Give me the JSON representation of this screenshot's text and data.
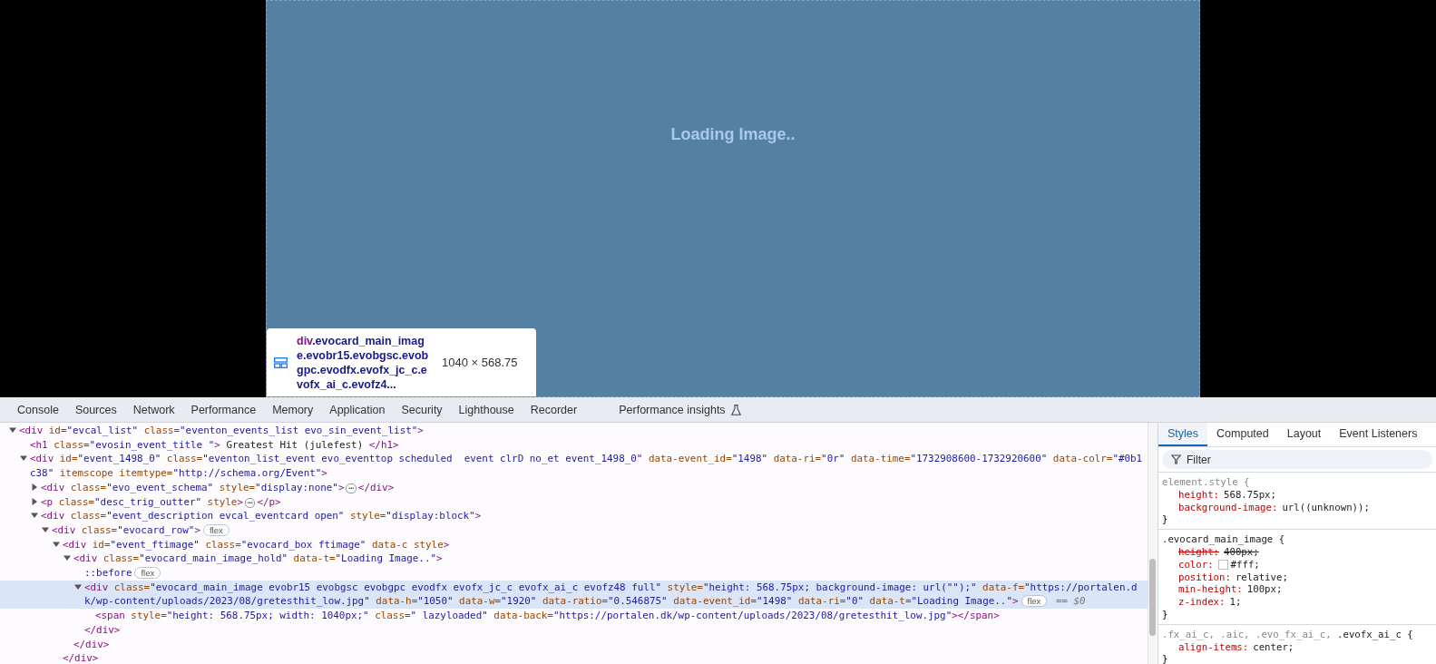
{
  "page": {
    "loading_text": "Loading Image..",
    "inspect_tooltip": {
      "tag": "div",
      "classes": ".evocard_main_image.evobr15.evobgsc.evobgpc.evodfx.evofx_jc_c.evofx_ai_c.evofz4...",
      "size": "1040 × 568.75"
    }
  },
  "devtools": {
    "tabs": [
      {
        "label": "Console",
        "selected": false
      },
      {
        "label": "Sources",
        "selected": false
      },
      {
        "label": "Network",
        "selected": false
      },
      {
        "label": "Performance",
        "selected": false
      },
      {
        "label": "Memory",
        "selected": false
      },
      {
        "label": "Application",
        "selected": false
      },
      {
        "label": "Security",
        "selected": false
      },
      {
        "label": "Lighthouse",
        "selected": false
      },
      {
        "label": "Recorder",
        "selected": false
      },
      {
        "label": "Performance insights",
        "selected": false,
        "kind": "experiment"
      }
    ],
    "dom_tree": [
      {
        "expanded": true,
        "selected": false,
        "tokens": [
          {
            "kind": "tag",
            "text": "<div"
          },
          {
            "kind": "attr",
            "text": " id="
          },
          {
            "kind": "value",
            "text": "\"evcal_list\""
          },
          {
            "kind": "attr",
            "text": " class="
          },
          {
            "kind": "value",
            "text": "\"eventon_events_list evo_sin_event_list\""
          },
          {
            "kind": "tag",
            "text": ">"
          }
        ],
        "children": [
          {
            "selected": false,
            "tokens": [
              {
                "kind": "tag",
                "text": "<h1"
              },
              {
                "kind": "attr",
                "text": " class="
              },
              {
                "kind": "value",
                "text": "\"evosin_event_title \""
              },
              {
                "kind": "tag",
                "text": ">"
              },
              {
                "kind": "text",
                "text": " Greatest Hit (julefest) "
              },
              {
                "kind": "tag",
                "text": "</h1>"
              }
            ]
          },
          {
            "expanded": true,
            "selected": false,
            "tokens": [
              {
                "kind": "tag",
                "text": "<div"
              },
              {
                "kind": "attr",
                "text": " id="
              },
              {
                "kind": "value",
                "text": "\"event_1498_0\""
              },
              {
                "kind": "attr",
                "text": " class="
              },
              {
                "kind": "value",
                "text": "\"eventon_list_event evo_eventtop scheduled  event clrD no_et event_1498_0\""
              },
              {
                "kind": "attr",
                "text": " data-event_id="
              },
              {
                "kind": "value",
                "text": "\"1498\""
              },
              {
                "kind": "attr",
                "text": " data-ri="
              },
              {
                "kind": "value",
                "text": "\"0r\""
              },
              {
                "kind": "attr",
                "text": " data-time="
              },
              {
                "kind": "value",
                "text": "\"1732908600-1732920600\""
              },
              {
                "kind": "attr",
                "text": " data-colr="
              },
              {
                "kind": "value",
                "text": "\"#0b1"
              },
              {
                "kind": "wrap"
              },
              {
                "kind": "value",
                "text": "c38\""
              },
              {
                "kind": "attr",
                "text": " itemscope"
              },
              {
                "kind": "attr",
                "text": " itemtype="
              },
              {
                "kind": "value",
                "text": "\"http://schema.org/Event\""
              },
              {
                "kind": "tag",
                "text": ">"
              }
            ],
            "children": [
              {
                "expanded": false,
                "selected": false,
                "tokens": [
                  {
                    "kind": "tag",
                    "text": "<div"
                  },
                  {
                    "kind": "attr",
                    "text": " class="
                  },
                  {
                    "kind": "value",
                    "text": "\"evo_event_schema\""
                  },
                  {
                    "kind": "attr",
                    "text": " style="
                  },
                  {
                    "kind": "value",
                    "text": "\"display:none\""
                  },
                  {
                    "kind": "tag",
                    "text": ">"
                  },
                  {
                    "kind": "ellipsis",
                    "text": "⋯"
                  },
                  {
                    "kind": "tag",
                    "text": "</div>"
                  }
                ]
              },
              {
                "expanded": false,
                "selected": false,
                "tokens": [
                  {
                    "kind": "tag",
                    "text": "<p"
                  },
                  {
                    "kind": "attr",
                    "text": " class="
                  },
                  {
                    "kind": "value",
                    "text": "\"desc_trig_outter\""
                  },
                  {
                    "kind": "attr",
                    "text": " style"
                  },
                  {
                    "kind": "tag",
                    "text": ">"
                  },
                  {
                    "kind": "ellipsis",
                    "text": "⋯"
                  },
                  {
                    "kind": "tag",
                    "text": "</p>"
                  }
                ]
              },
              {
                "expanded": true,
                "selected": false,
                "tokens": [
                  {
                    "kind": "tag",
                    "text": "<div"
                  },
                  {
                    "kind": "attr",
                    "text": " class="
                  },
                  {
                    "kind": "value",
                    "text": "\"event_description evcal_eventcard open\""
                  },
                  {
                    "kind": "attr",
                    "text": " style="
                  },
                  {
                    "kind": "value",
                    "text": "\"display:block\""
                  },
                  {
                    "kind": "tag",
                    "text": ">"
                  }
                ],
                "children": [
                  {
                    "expanded": true,
                    "selected": false,
                    "tokens": [
                      {
                        "kind": "tag",
                        "text": "<div"
                      },
                      {
                        "kind": "attr",
                        "text": " class="
                      },
                      {
                        "kind": "value",
                        "text": "\"evocard_row\""
                      },
                      {
                        "kind": "tag",
                        "text": ">"
                      },
                      {
                        "kind": "badge",
                        "text": "flex"
                      }
                    ],
                    "children": [
                      {
                        "expanded": true,
                        "selected": false,
                        "closing": "</div>",
                        "tokens": [
                          {
                            "kind": "tag",
                            "text": "<div"
                          },
                          {
                            "kind": "attr",
                            "text": " id="
                          },
                          {
                            "kind": "value",
                            "text": "\"event_ftimage\""
                          },
                          {
                            "kind": "attr",
                            "text": " class="
                          },
                          {
                            "kind": "value",
                            "text": "\"evocard_box ftimage\""
                          },
                          {
                            "kind": "attr",
                            "text": " data-c"
                          },
                          {
                            "kind": "attr",
                            "text": " style"
                          },
                          {
                            "kind": "tag",
                            "text": ">"
                          }
                        ],
                        "children": [
                          {
                            "expanded": true,
                            "selected": false,
                            "closing": "</div>",
                            "tokens": [
                              {
                                "kind": "tag",
                                "text": "<div"
                              },
                              {
                                "kind": "attr",
                                "text": " class="
                              },
                              {
                                "kind": "value",
                                "text": "\"evocard_main_image_hold\""
                              },
                              {
                                "kind": "attr",
                                "text": " data-t="
                              },
                              {
                                "kind": "value",
                                "text": "\"Loading Image..\""
                              },
                              {
                                "kind": "tag",
                                "text": ">"
                              }
                            ],
                            "children": [
                              {
                                "selected": false,
                                "tokens": [
                                  {
                                    "kind": "pseudo",
                                    "text": "::before"
                                  },
                                  {
                                    "kind": "badge",
                                    "text": "flex"
                                  }
                                ]
                              },
                              {
                                "expanded": true,
                                "selected": true,
                                "closing": "</div>",
                                "tokens": [
                                  {
                                    "kind": "tag",
                                    "text": "<div"
                                  },
                                  {
                                    "kind": "attr",
                                    "text": " class="
                                  },
                                  {
                                    "kind": "value",
                                    "text": "\"evocard_main_image evobr15 evobgsc evobgpc evodfx evofx_jc_c evofx_ai_c evofz48 full\""
                                  },
                                  {
                                    "kind": "attr",
                                    "text": " style="
                                  },
                                  {
                                    "kind": "value",
                                    "text": "\"height: 568.75px; background-image: url(\"\");\""
                                  },
                                  {
                                    "kind": "attr",
                                    "text": " data-f="
                                  },
                                  {
                                    "kind": "value",
                                    "text": "\"https://portalen.d"
                                  },
                                  {
                                    "kind": "wrap"
                                  },
                                  {
                                    "kind": "value",
                                    "text": "k/wp-content/uploads/2023/08/gretesthit_low.jpg\""
                                  },
                                  {
                                    "kind": "attr",
                                    "text": " data-h="
                                  },
                                  {
                                    "kind": "value",
                                    "text": "\"1050\""
                                  },
                                  {
                                    "kind": "attr",
                                    "text": " data-w="
                                  },
                                  {
                                    "kind": "value",
                                    "text": "\"1920\""
                                  },
                                  {
                                    "kind": "attr",
                                    "text": " data-ratio="
                                  },
                                  {
                                    "kind": "value",
                                    "text": "\"0.546875\""
                                  },
                                  {
                                    "kind": "attr",
                                    "text": " data-event_id="
                                  },
                                  {
                                    "kind": "value",
                                    "text": "\"1498\""
                                  },
                                  {
                                    "kind": "attr",
                                    "text": " data-ri="
                                  },
                                  {
                                    "kind": "value",
                                    "text": "\"0\""
                                  },
                                  {
                                    "kind": "attr",
                                    "text": " data-t="
                                  },
                                  {
                                    "kind": "value",
                                    "text": "\"Loading Image..\""
                                  },
                                  {
                                    "kind": "tag",
                                    "text": ">"
                                  },
                                  {
                                    "kind": "badge",
                                    "text": "flex"
                                  },
                                  {
                                    "kind": "ref",
                                    "text": "== $0"
                                  }
                                ],
                                "children": [
                                  {
                                    "selected": false,
                                    "tokens": [
                                      {
                                        "kind": "tag",
                                        "text": "<span"
                                      },
                                      {
                                        "kind": "attr",
                                        "text": " style="
                                      },
                                      {
                                        "kind": "value",
                                        "text": "\"height: 568.75px; width: 1040px;\""
                                      },
                                      {
                                        "kind": "attr",
                                        "text": " class="
                                      },
                                      {
                                        "kind": "value",
                                        "text": "\" lazyloaded\""
                                      },
                                      {
                                        "kind": "attr",
                                        "text": " data-back="
                                      },
                                      {
                                        "kind": "value",
                                        "text": "\"https://portalen.dk/wp-content/uploads/2023/08/gretesthit_low.jpg\""
                                      },
                                      {
                                        "kind": "tag",
                                        "text": "></span>"
                                      }
                                    ]
                                  }
                                ]
                              }
                            ]
                          }
                        ]
                      }
                    ]
                  }
                ]
              }
            ]
          }
        ]
      }
    ],
    "styles_tabs": [
      {
        "label": "Styles",
        "selected": true
      },
      {
        "label": "Computed",
        "selected": false
      },
      {
        "label": "Layout",
        "selected": false
      },
      {
        "label": "Event Listeners",
        "selected": false
      }
    ],
    "filter": {
      "placeholder": "Filter"
    },
    "rules": [
      {
        "selector": [
          {
            "text": "element.style {",
            "matched": false
          }
        ],
        "declarations": [
          {
            "property": "height:",
            "value": "568.75px;",
            "overridden": false
          },
          {
            "property": "background-image:",
            "value": "url((unknown));",
            "overridden": false
          }
        ],
        "close": "}"
      },
      {
        "selector": [
          {
            "text": ".evocard_main_image {",
            "matched": true
          }
        ],
        "declarations": [
          {
            "property": "height:",
            "value": "400px;",
            "overridden": true
          },
          {
            "property": "color:",
            "value": "#fff;",
            "overridden": false,
            "color": "#ffffff"
          },
          {
            "property": "position:",
            "value": "relative;",
            "overridden": false
          },
          {
            "property": "min-height:",
            "value": "100px;",
            "overridden": false
          },
          {
            "property": "z-index:",
            "value": "1;",
            "overridden": false
          }
        ],
        "close": "}"
      },
      {
        "selector": [
          {
            "text": ".fx_ai_c, .aic, .evo_fx_ai_c, ",
            "matched": false
          },
          {
            "text": ".evofx_ai_c {",
            "matched": true
          }
        ],
        "declarations": [
          {
            "property": "align-items:",
            "value": "center;",
            "overridden": false
          }
        ],
        "close": "}"
      }
    ]
  }
}
